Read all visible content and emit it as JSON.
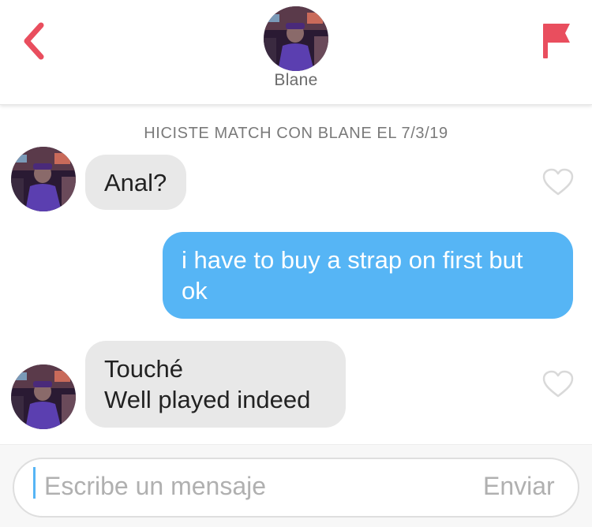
{
  "header": {
    "contact_name": "Blane",
    "accent_color": "#e94e5e",
    "back_icon": "chevron-left-icon",
    "report_icon": "flag-icon"
  },
  "thread": {
    "match_notice": "HICISTE MATCH CON BLANE EL 7/3/19",
    "messages": [
      {
        "direction": "incoming",
        "lines": [
          "Anal?"
        ],
        "liked": false
      },
      {
        "direction": "outgoing",
        "lines": [
          "i have to buy a strap on first but",
          "ok"
        ]
      },
      {
        "direction": "incoming",
        "lines": [
          "Touché",
          "Well played indeed"
        ],
        "liked": false
      }
    ],
    "incoming_bubble_color": "#e8e8e8",
    "outgoing_bubble_color": "#56b5f5"
  },
  "composer": {
    "placeholder": "Escribe un mensaje",
    "send_label": "Enviar"
  }
}
